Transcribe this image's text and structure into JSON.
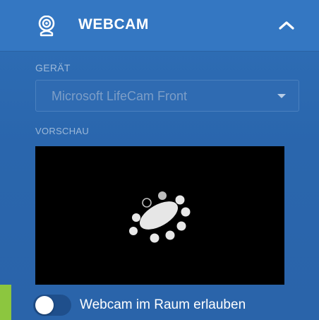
{
  "section": {
    "title": "WEBCAM",
    "icon": "webcam-icon",
    "collapse_icon": "chevron-up-icon",
    "expanded": true
  },
  "device": {
    "label": "GERÄT",
    "selected": "Microsoft LifeCam Front",
    "icon": "caret-down-icon"
  },
  "preview": {
    "label": "VORSCHAU",
    "state_icon": "loading-spinner-icon"
  },
  "toggle": {
    "label": "Webcam im Raum erlauben",
    "checked": false
  },
  "colors": {
    "panel": "#2f6fb7",
    "header": "#3477c2",
    "accent_green": "#8cc63f",
    "preview_bg": "#000000"
  }
}
